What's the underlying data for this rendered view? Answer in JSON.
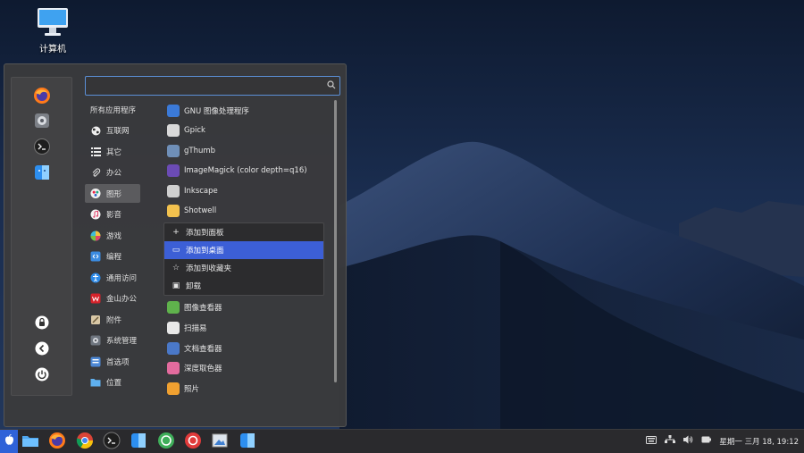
{
  "desktop": {
    "icon_label": "计算机"
  },
  "search": {
    "placeholder": "",
    "value": ""
  },
  "categories": [
    {
      "label": "所有应用程序",
      "icon": "none"
    },
    {
      "label": "互联网",
      "icon": "globe-icon"
    },
    {
      "label": "其它",
      "icon": "list-icon"
    },
    {
      "label": "办公",
      "icon": "paperclip-icon"
    },
    {
      "label": "图形",
      "icon": "graphics-icon"
    },
    {
      "label": "影音",
      "icon": "music-icon"
    },
    {
      "label": "游戏",
      "icon": "gamepad-icon"
    },
    {
      "label": "编程",
      "icon": "code-icon"
    },
    {
      "label": "通用访问",
      "icon": "accessibility-icon"
    },
    {
      "label": "金山办公",
      "icon": "wps-icon"
    },
    {
      "label": "附件",
      "icon": "accessories-icon"
    },
    {
      "label": "系统管理",
      "icon": "system-icon"
    },
    {
      "label": "首选项",
      "icon": "preferences-icon"
    },
    {
      "label": "位置",
      "icon": "folder-icon"
    }
  ],
  "apps_top": [
    {
      "label": "GNU 图像处理程序",
      "color": "#3b7ad8"
    },
    {
      "label": "Gpick",
      "color": "#d9d9d9"
    },
    {
      "label": "gThumb",
      "color": "#6f8fb8"
    },
    {
      "label": "ImageMagick (color depth=q16)",
      "color": "#6b4bb5"
    },
    {
      "label": "Inkscape",
      "color": "#cfcfcf"
    },
    {
      "label": "Shotwell",
      "color": "#f2c14e"
    }
  ],
  "context_menu": [
    {
      "label": "添加到面板",
      "icon": "+"
    },
    {
      "label": "添加到桌面",
      "icon": "▭"
    },
    {
      "label": "添加到收藏夹",
      "icon": "☆"
    },
    {
      "label": "卸载",
      "icon": "▣"
    }
  ],
  "apps_bottom": [
    {
      "label": "图像查看器",
      "color": "#5fb24c"
    },
    {
      "label": "扫描易",
      "color": "#e8e8e8"
    },
    {
      "label": "文档查看器",
      "color": "#4a78c8"
    },
    {
      "label": "深度取色器",
      "color": "#e36b9e"
    },
    {
      "label": "照片",
      "color": "#f0a030"
    }
  ],
  "clock": "星期一 三月 18, 19:12",
  "colors": {
    "accent": "#3c5fd6",
    "taskbar": "#2a2a2d",
    "menu_bg": "#3a3a3c"
  }
}
